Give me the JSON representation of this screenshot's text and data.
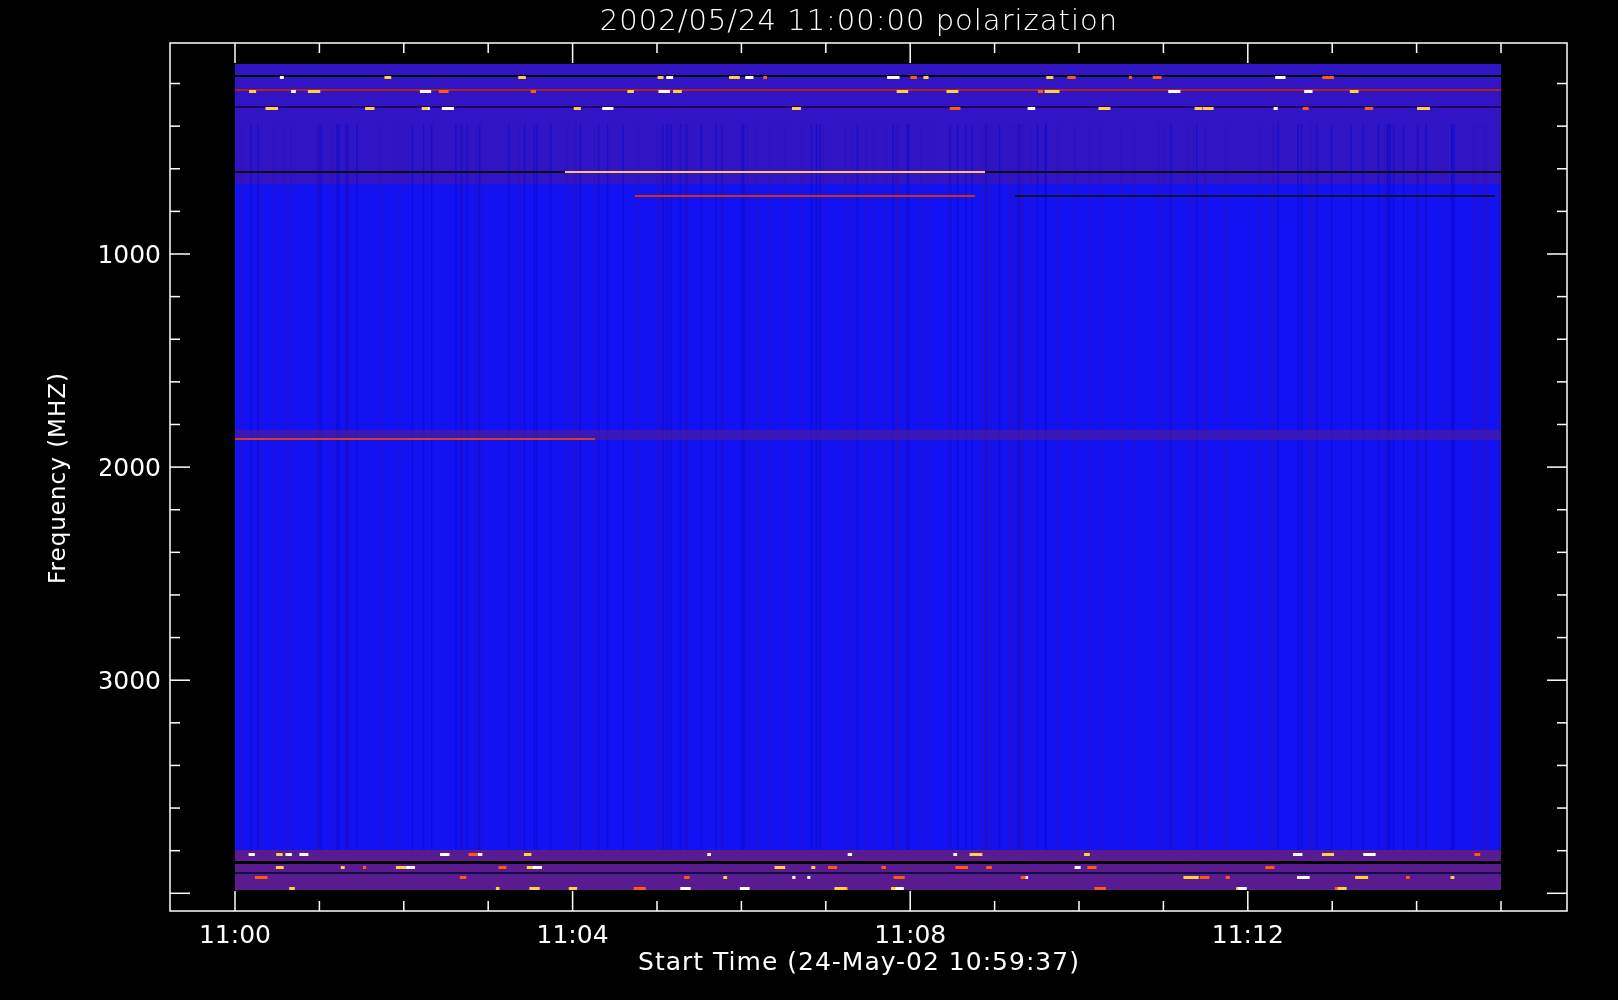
{
  "title": "2002/05/24 11:00:00 polarization",
  "plot": {
    "xlabel": "Start Time (24-May-02 10:59:37)",
    "ylabel": "Frequency (MHZ)",
    "xtick_labels": [
      "11:00",
      "11:04",
      "11:08",
      "11:12"
    ],
    "ytick_labels": [
      "1000",
      "2000",
      "3000"
    ]
  }
}
